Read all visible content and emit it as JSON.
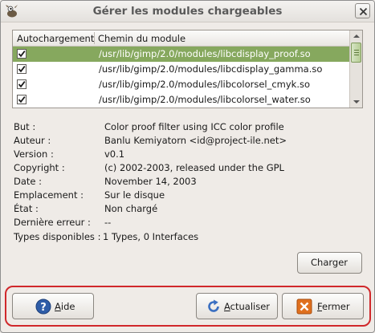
{
  "window": {
    "title": "Gérer les modules chargeables"
  },
  "list": {
    "columns": [
      "Autochargement",
      "Chemin du module"
    ],
    "rows": [
      {
        "checked": true,
        "path": "/usr/lib/gimp/2.0/modules/libcdisplay_proof.so",
        "selected": true
      },
      {
        "checked": true,
        "path": "/usr/lib/gimp/2.0/modules/libcdisplay_gamma.so",
        "selected": false
      },
      {
        "checked": true,
        "path": "/usr/lib/gimp/2.0/modules/libcolorsel_cmyk.so",
        "selected": false
      },
      {
        "checked": true,
        "path": "/usr/lib/gimp/2.0/modules/libcolorsel_water.so",
        "selected": false
      }
    ]
  },
  "info": [
    {
      "label": "But :",
      "value": "Color proof filter using ICC color profile"
    },
    {
      "label": "Auteur :",
      "value": "Banlu Kemiyatorn <id@project-ile.net>"
    },
    {
      "label": "Version :",
      "value": "v0.1"
    },
    {
      "label": "Copyright :",
      "value": "(c) 2002-2003, released under the GPL"
    },
    {
      "label": "Date :",
      "value": "November 14, 2003"
    },
    {
      "label": "Emplacement :",
      "value": "Sur le disque"
    },
    {
      "label": "État :",
      "value": "Non chargé"
    },
    {
      "label": "Dernière erreur :",
      "value": "--"
    }
  ],
  "types": {
    "label": "Types disponibles :",
    "value": "1 Types, 0 Interfaces"
  },
  "buttons": {
    "load": "Charger",
    "help": {
      "mnemonic": "A",
      "rest": "ide"
    },
    "refresh": {
      "mnemonic": "A",
      "rest": "ctualiser"
    },
    "close": {
      "mnemonic": "F",
      "rest": "ermer"
    }
  },
  "icons": [
    "gimp-wilber-icon",
    "close-icon",
    "help-icon",
    "refresh-icon",
    "cancel-icon"
  ],
  "colors": {
    "selection": "#86a85e",
    "focus_outline": "#d0282b",
    "close_icon": "#e0701e",
    "help_icon": "#2f5da8"
  }
}
